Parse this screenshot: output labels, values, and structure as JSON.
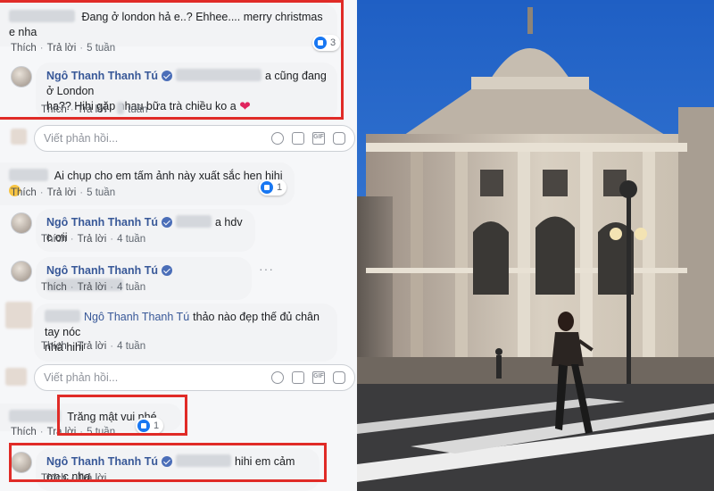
{
  "actions": {
    "like": "Thích",
    "reply": "Trả lời"
  },
  "comments": [
    {
      "text": "Đang ở london hả e..? Ehhee.... merry christmas e nha",
      "time": "5 tuần",
      "reactions": "3"
    },
    {
      "author": "Ngô Thanh Thanh Tú",
      "text_line1": "a cũng đang ở London",
      "text_line2": "ha?? Hihi gặp nhau bữa trà chiều ko a",
      "time": "tuần"
    },
    {
      "text": "Ai chụp cho em tấm ảnh này xuất sắc hen hihi",
      "time": "5 tuần",
      "reactions": "1"
    },
    {
      "author": "Ngô Thanh Thanh Tú",
      "text": "a hdv c ơii",
      "time": "4 tuần"
    },
    {
      "author": "Ngô Thanh Thanh Tú",
      "time": "4 tuần"
    },
    {
      "mention": "Ngô Thanh Thanh Tú",
      "text_line1": "thảo nào đẹp thế đủ chân tay nóc",
      "text_line2": "nhà hihi",
      "time": "4 tuần"
    },
    {
      "text": "Trăng mật vui nhé",
      "time": "5 tuần",
      "reactions": "1"
    },
    {
      "author": "Ngô Thanh Thanh Tú",
      "text": "hihi em cảm ơn c nha"
    }
  ],
  "reply_box": {
    "placeholder": "Viết phản hồi..."
  },
  "icons": [
    "emoji-icon",
    "camera-icon",
    "gif-icon",
    "sticker-icon",
    "like-icon",
    "verified-icon",
    "heart-icon",
    "more-icon"
  ],
  "colors": {
    "highlight": "#e02b27",
    "name": "#385898",
    "like": "#1877f2",
    "sky": "#2f6fd0"
  }
}
